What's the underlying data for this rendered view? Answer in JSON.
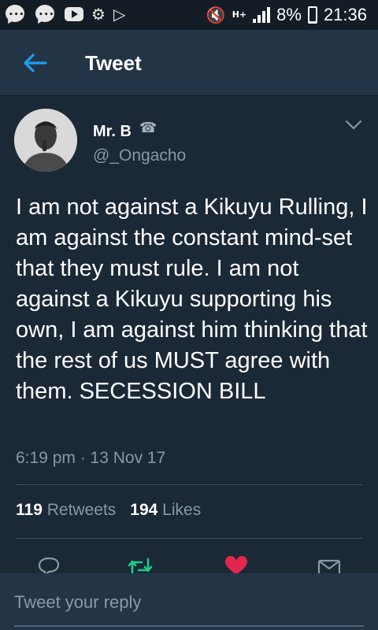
{
  "status_bar": {
    "battery": "8%",
    "time": "21:36",
    "network": "H+",
    "battery_level": 0.08,
    "icons": [
      "chat-icon",
      "chat-icon",
      "youtube-icon",
      "settings-icon",
      "play-store-icon",
      "mute-icon",
      "signal-icon",
      "battery-icon"
    ]
  },
  "header": {
    "title": "Tweet",
    "back_icon": "arrow-left-icon"
  },
  "tweet": {
    "display_name": "Mr. B",
    "name_icon": "☎",
    "handle": "@_Ongacho",
    "text": "I am not against a Kikuyu Rulling, I am against the constant mind-set that they must rule. I am not against a Kikuyu supporting his own, I am against him thinking that the rest of us MUST agree with them. SECESSION BILL",
    "timestamp": "6:19 pm · 13 Nov 17"
  },
  "stats": {
    "retweet_count": "119",
    "retweet_label": "Retweets",
    "like_count": "194",
    "like_label": "Likes"
  },
  "actions": [
    {
      "icon": "reply-icon"
    },
    {
      "icon": "retweet-icon",
      "color": "#19cf86"
    },
    {
      "icon": "heart-icon",
      "color": "#e2264d"
    },
    {
      "icon": "message-icon"
    }
  ],
  "reply": {
    "placeholder": "Tweet your reply"
  },
  "colors": {
    "background": "#1b2836",
    "header": "#243447",
    "accent": "#1da1f2",
    "secondary_text": "#8899a6"
  }
}
